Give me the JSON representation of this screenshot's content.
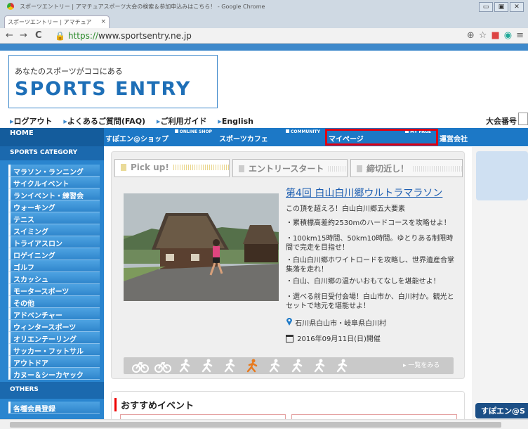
{
  "browser": {
    "window_title": "スポーツエントリー | アマチュアスポーツ大会の検索＆参加申込みはこちら！ - Google Chrome",
    "tab_title": "スポーツエントリー | アマチュア",
    "tab_close": "×",
    "url_scheme": "https://",
    "url_host": "www.sportsentry.ne.jp",
    "back": "←",
    "forward": "→",
    "reload": "C",
    "window_buttons": [
      "▭",
      "▣",
      "✕"
    ]
  },
  "header": {
    "tagline": "あなたのスポーツがココにある",
    "brand": "SPORTS ENTRY",
    "utility_links": [
      "ログアウト",
      "よくあるご質問(FAQ)",
      "ご利用ガイド",
      "English"
    ],
    "tournament_no_label": "大会番号"
  },
  "nav": {
    "home": "HOME",
    "items": [
      {
        "label": "すぽエン@ショップ",
        "sub": "ONLINE SHOP"
      },
      {
        "label": "スポーツカフェ",
        "sub": "COMMUNITY"
      },
      {
        "label": "マイページ",
        "sub": "MY PAGE"
      },
      {
        "label": "運営会社",
        "sub": ""
      }
    ]
  },
  "sidebar": {
    "category_heading": "SPORTS CATEGORY",
    "categories": [
      "マラソン・ランニング",
      "サイクルイベント",
      "ランイベント・練習会",
      "ウォーキング",
      "テニス",
      "スイミング",
      "トライアスロン",
      "ロゲイニング",
      "ゴルフ",
      "スカッシュ",
      "モータースポーツ",
      "その他",
      "アドベンチャー",
      "ウィンタースポーツ",
      "オリエンテーリング",
      "サッカー・フットサル",
      "アウトドア",
      "カヌー＆シーカヤック"
    ],
    "others_heading": "OTHERS",
    "others": [
      "各種会員登録"
    ]
  },
  "tabs": [
    "Pick up!",
    "エントリースタート",
    "締切近し！"
  ],
  "event": {
    "title": "第4回 白山白川郷ウルトラマラソン",
    "lines": [
      "この頂を超えろ！白山白川郷五大要素",
      "・累積標高差約2530mのハードコースを攻略せよ！",
      "・100km15時間、50km10時間。ゆとりある制限時間で完走を目指せ！",
      "・白山白川郷ホワイトロードを攻略し、世界遺産合掌集落を走れ！",
      "・白山、白川郷の温かいおもてなしを堪能せよ！",
      "・選べる前日受付会場！白山市か、白川村か。観光とセットで地元を堪能せよ！"
    ],
    "location": "石川県白山市・岐阜県白川村",
    "date": "2016年09月11日(日)開催"
  },
  "carousel": {
    "see_all": "一覧をみる",
    "active_index": 5
  },
  "recommended": {
    "title": "おすすめイベント"
  },
  "floating": {
    "label": "すぽエン@S"
  },
  "colors": {
    "accent": "#1c78c6",
    "highlight": "#e00012",
    "runner_active": "#e87a1e"
  }
}
